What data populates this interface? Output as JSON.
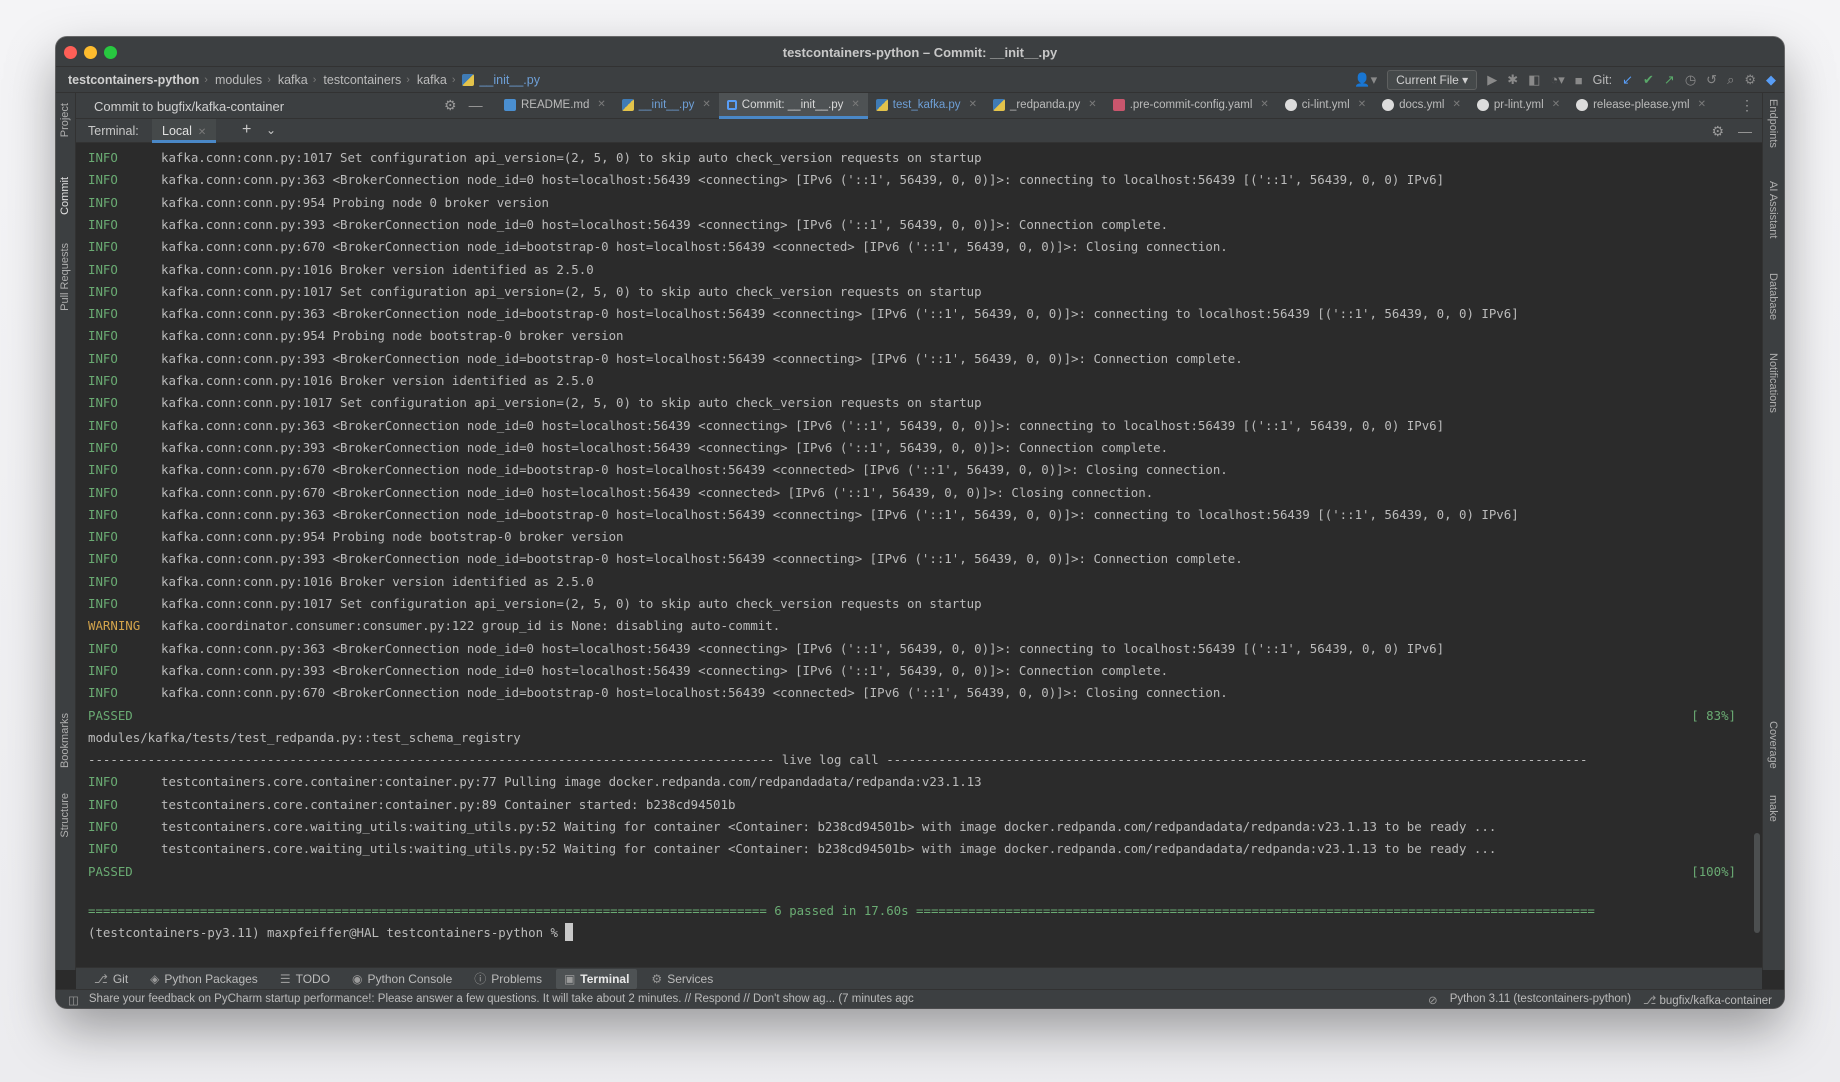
{
  "window": {
    "title": "testcontainers-python – Commit: __init__.py"
  },
  "breadcrumbs": [
    "testcontainers-python",
    "modules",
    "kafka",
    "testcontainers",
    "kafka",
    "__init__.py"
  ],
  "navbar": {
    "run_config": "Current File",
    "git_label": "Git:"
  },
  "left_tools": [
    "Project",
    "Commit",
    "Pull Requests",
    "Bookmarks",
    "Structure"
  ],
  "right_tools": [
    "Endpoints",
    "AI Assistant",
    "Database",
    "Notifications",
    "Coverage",
    "make"
  ],
  "commit_panel": {
    "title": "Commit to bugfix/kafka-container"
  },
  "editor_tabs": [
    {
      "label": "README.md",
      "icon": "markdown-icon",
      "active": false
    },
    {
      "label": "__init__.py",
      "icon": "python-file-icon",
      "active": false
    },
    {
      "label": "Commit: __init__.py",
      "icon": "commit-icon",
      "active": true
    },
    {
      "label": "test_kafka.py",
      "icon": "python-file-icon",
      "active": false
    },
    {
      "label": "_redpanda.py",
      "icon": "python-file-icon",
      "active": false
    },
    {
      "label": ".pre-commit-config.yaml",
      "icon": "yaml-icon",
      "active": false
    },
    {
      "label": "ci-lint.yml",
      "icon": "github-icon",
      "active": false
    },
    {
      "label": "docs.yml",
      "icon": "github-icon",
      "active": false
    },
    {
      "label": "pr-lint.yml",
      "icon": "github-icon",
      "active": false
    },
    {
      "label": "release-please.yml",
      "icon": "github-icon",
      "active": false
    }
  ],
  "terminal": {
    "label": "Terminal:",
    "tab": "Local",
    "lines": [
      {
        "level": "INFO",
        "text": "kafka.conn:conn.py:1017 Set configuration api_version=(2, 5, 0) to skip auto check_version requests on startup"
      },
      {
        "level": "INFO",
        "text": "kafka.conn:conn.py:363 <BrokerConnection node_id=0 host=localhost:56439 <connecting> [IPv6 ('::1', 56439, 0, 0)]>: connecting to localhost:56439 [('::1', 56439, 0, 0) IPv6]"
      },
      {
        "level": "INFO",
        "text": "kafka.conn:conn.py:954 Probing node 0 broker version"
      },
      {
        "level": "INFO",
        "text": "kafka.conn:conn.py:393 <BrokerConnection node_id=0 host=localhost:56439 <connecting> [IPv6 ('::1', 56439, 0, 0)]>: Connection complete."
      },
      {
        "level": "INFO",
        "text": "kafka.conn:conn.py:670 <BrokerConnection node_id=bootstrap-0 host=localhost:56439 <connected> [IPv6 ('::1', 56439, 0, 0)]>: Closing connection."
      },
      {
        "level": "INFO",
        "text": "kafka.conn:conn.py:1016 Broker version identified as 2.5.0"
      },
      {
        "level": "INFO",
        "text": "kafka.conn:conn.py:1017 Set configuration api_version=(2, 5, 0) to skip auto check_version requests on startup"
      },
      {
        "level": "INFO",
        "text": "kafka.conn:conn.py:363 <BrokerConnection node_id=bootstrap-0 host=localhost:56439 <connecting> [IPv6 ('::1', 56439, 0, 0)]>: connecting to localhost:56439 [('::1', 56439, 0, 0) IPv6]"
      },
      {
        "level": "INFO",
        "text": "kafka.conn:conn.py:954 Probing node bootstrap-0 broker version"
      },
      {
        "level": "INFO",
        "text": "kafka.conn:conn.py:393 <BrokerConnection node_id=bootstrap-0 host=localhost:56439 <connecting> [IPv6 ('::1', 56439, 0, 0)]>: Connection complete."
      },
      {
        "level": "INFO",
        "text": "kafka.conn:conn.py:1016 Broker version identified as 2.5.0"
      },
      {
        "level": "INFO",
        "text": "kafka.conn:conn.py:1017 Set configuration api_version=(2, 5, 0) to skip auto check_version requests on startup"
      },
      {
        "level": "INFO",
        "text": "kafka.conn:conn.py:363 <BrokerConnection node_id=0 host=localhost:56439 <connecting> [IPv6 ('::1', 56439, 0, 0)]>: connecting to localhost:56439 [('::1', 56439, 0, 0) IPv6]"
      },
      {
        "level": "INFO",
        "text": "kafka.conn:conn.py:393 <BrokerConnection node_id=0 host=localhost:56439 <connecting> [IPv6 ('::1', 56439, 0, 0)]>: Connection complete."
      },
      {
        "level": "INFO",
        "text": "kafka.conn:conn.py:670 <BrokerConnection node_id=bootstrap-0 host=localhost:56439 <connected> [IPv6 ('::1', 56439, 0, 0)]>: Closing connection."
      },
      {
        "level": "INFO",
        "text": "kafka.conn:conn.py:670 <BrokerConnection node_id=0 host=localhost:56439 <connected> [IPv6 ('::1', 56439, 0, 0)]>: Closing connection."
      },
      {
        "level": "INFO",
        "text": "kafka.conn:conn.py:363 <BrokerConnection node_id=bootstrap-0 host=localhost:56439 <connecting> [IPv6 ('::1', 56439, 0, 0)]>: connecting to localhost:56439 [('::1', 56439, 0, 0) IPv6]"
      },
      {
        "level": "INFO",
        "text": "kafka.conn:conn.py:954 Probing node bootstrap-0 broker version"
      },
      {
        "level": "INFO",
        "text": "kafka.conn:conn.py:393 <BrokerConnection node_id=bootstrap-0 host=localhost:56439 <connecting> [IPv6 ('::1', 56439, 0, 0)]>: Connection complete."
      },
      {
        "level": "INFO",
        "text": "kafka.conn:conn.py:1016 Broker version identified as 2.5.0"
      },
      {
        "level": "INFO",
        "text": "kafka.conn:conn.py:1017 Set configuration api_version=(2, 5, 0) to skip auto check_version requests on startup"
      },
      {
        "level": "WARNING",
        "text": "kafka.coordinator.consumer:consumer.py:122 group_id is None: disabling auto-commit."
      },
      {
        "level": "INFO",
        "text": "kafka.conn:conn.py:363 <BrokerConnection node_id=0 host=localhost:56439 <connecting> [IPv6 ('::1', 56439, 0, 0)]>: connecting to localhost:56439 [('::1', 56439, 0, 0) IPv6]"
      },
      {
        "level": "INFO",
        "text": "kafka.conn:conn.py:393 <BrokerConnection node_id=0 host=localhost:56439 <connecting> [IPv6 ('::1', 56439, 0, 0)]>: Connection complete."
      },
      {
        "level": "INFO",
        "text": "kafka.conn:conn.py:670 <BrokerConnection node_id=bootstrap-0 host=localhost:56439 <connected> [IPv6 ('::1', 56439, 0, 0)]>: Closing connection."
      }
    ],
    "passed_label": "PASSED",
    "passed_pct_1": "[ 83%]",
    "test_path": "modules/kafka/tests/test_redpanda.py::test_schema_registry",
    "live_log_header": "-------------------------------------------------------------------------------------------- live log call ----------------------------------------------------------------------------------------------",
    "lines2": [
      {
        "level": "INFO",
        "text": "testcontainers.core.container:container.py:77 Pulling image docker.redpanda.com/redpandadata/redpanda:v23.1.13"
      },
      {
        "level": "INFO",
        "text": "testcontainers.core.container:container.py:89 Container started: b238cd94501b"
      },
      {
        "level": "INFO",
        "text": "testcontainers.core.waiting_utils:waiting_utils.py:52 Waiting for container <Container: b238cd94501b> with image docker.redpanda.com/redpandadata/redpanda:v23.1.13 to be ready ..."
      },
      {
        "level": "INFO",
        "text": "testcontainers.core.waiting_utils:waiting_utils.py:52 Waiting for container <Container: b238cd94501b> with image docker.redpanda.com/redpandadata/redpanda:v23.1.13 to be ready ..."
      }
    ],
    "passed_pct_2": "[100%]",
    "summary": "=========================================================================================== 6 passed in 17.60s ===========================================================================================",
    "prompt": "(testcontainers-py3.11) maxpfeiffer@HAL testcontainers-python % "
  },
  "bottom_tabs": [
    {
      "label": "Git",
      "icon": "⎇",
      "active": false
    },
    {
      "label": "Python Packages",
      "icon": "◈",
      "active": false
    },
    {
      "label": "TODO",
      "icon": "☰",
      "active": false
    },
    {
      "label": "Python Console",
      "icon": "◉",
      "active": false
    },
    {
      "label": "Problems",
      "icon": "ⓘ",
      "active": false
    },
    {
      "label": "Terminal",
      "icon": "▣",
      "active": true
    },
    {
      "label": "Services",
      "icon": "⚙",
      "active": false
    }
  ],
  "status": {
    "message": "Share your feedback on PyCharm startup performance!: Please answer a few questions. It will take about 2 minutes. // Respond // Don't show ag... (7 minutes agc",
    "interpreter": "Python 3.11 (testcontainers-python)",
    "branch": "bugfix/kafka-container"
  }
}
